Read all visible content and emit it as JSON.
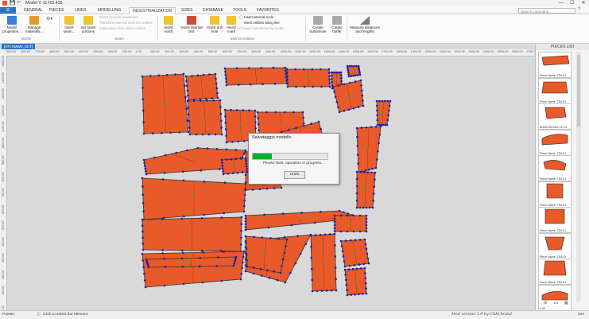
{
  "window": {
    "title": "Model V 11 R3.435",
    "min": "—",
    "max": "☐",
    "close": "✕"
  },
  "menu": {
    "file_label": "",
    "tabs": [
      "GENERAL",
      "PIECES",
      "LINES",
      "MODELLING",
      "INDUSTRIALIZATION",
      "SIZES",
      "DATABASE",
      "TOOLS",
      "FAVORITES"
    ],
    "active_tab": "INDUSTRIALIZATION",
    "search_placeholder": "Search command"
  },
  "ribbon": {
    "model_properties": "Model properties...",
    "manage_materials": "Manage materials...",
    "group_model": "Model",
    "insert_seam": "Insert seam...",
    "set_seam_portions": "Set seam portions",
    "seam_small_1": "Seam by point movement",
    "seam_small_2": "Transform internal lines into seams",
    "seam_small_3": "Copy piece from seam contour",
    "group_seam": "Seam",
    "insert_notch": "Insert notch",
    "insert_internal_text": "Insert internal text",
    "insert_drill": "Insert drill hole",
    "insert_mark": "Insert mark",
    "ie_small_1": "Insert internal circle",
    "ie_small_2": "Insert entities along line",
    "ie_small_3": "Change manufacturing mode...",
    "group_internal": "Internal entities",
    "create_buttonhole": "Create buttonhole",
    "create_buffer": "Create buffer",
    "measure_distances": "Measure distances and lengths"
  },
  "document_tab": "[NTI KMWK_8CT]",
  "ruler_h": [
    "-900.00",
    "-800.00",
    "-700.00",
    "-600.00",
    "-500.00",
    "-400.00",
    "-300.00",
    "-200.00",
    "-100.00",
    "0.00",
    "100.00",
    "200.00",
    "300.00",
    "400.00",
    "500.00",
    "600.00",
    "700.00",
    "800.00",
    "900.00",
    "1000.00",
    "1100.00",
    "1200.00",
    "1300.00",
    "1400.00",
    "1500.00",
    "1600.00",
    "1700.00",
    "1800.00",
    "1900.00",
    "2000.00",
    "2100.00",
    "2200.00",
    "2300.00",
    "2400.00",
    "2500.00",
    "2600.00",
    "2700.00"
  ],
  "ruler_v": [
    "1500.00",
    "1400.00",
    "1300.00",
    "1200.00",
    "1100.00",
    "1000.00",
    "900.00",
    "800.00",
    "700.00",
    "600.00",
    "500.00",
    "400.00",
    "300.00",
    "200.00",
    "100.00",
    "0.00"
  ],
  "dialog": {
    "title": "Salvataggio modello",
    "message": "Please Wait, operation in progress...",
    "undo": "Undo",
    "progress": 0.26
  },
  "panel": {
    "title": "PIECES LIST",
    "items": [
      {
        "label": "Piece Name: TEA 01"
      },
      {
        "label": "Piece Name: TEA 01"
      },
      {
        "label": "ANNOTATION: LD 01"
      },
      {
        "label": "Piece Name: TEA 01"
      },
      {
        "label": "Piece Name: TEA 01"
      },
      {
        "label": "Piece Name: TEA 01"
      },
      {
        "label": "Piece Name: TEA 01"
      },
      {
        "label": "Piece Name: TEA 01"
      },
      {
        "label": "Piece Name: TEA 01"
      },
      {
        "label": "# 00"
      }
    ],
    "count_label": "1/1"
  },
  "status": {
    "left": "Pointer",
    "hint": "Click to select the element.",
    "brand": "Mod version 1.0 by CSM brand",
    "unit": "mm"
  },
  "colors": {
    "piece_fill": "#e85a2a",
    "piece_stroke": "#333333",
    "point": "#1b1fa8",
    "accent": "#2b73c4",
    "progress": "#06b025"
  }
}
